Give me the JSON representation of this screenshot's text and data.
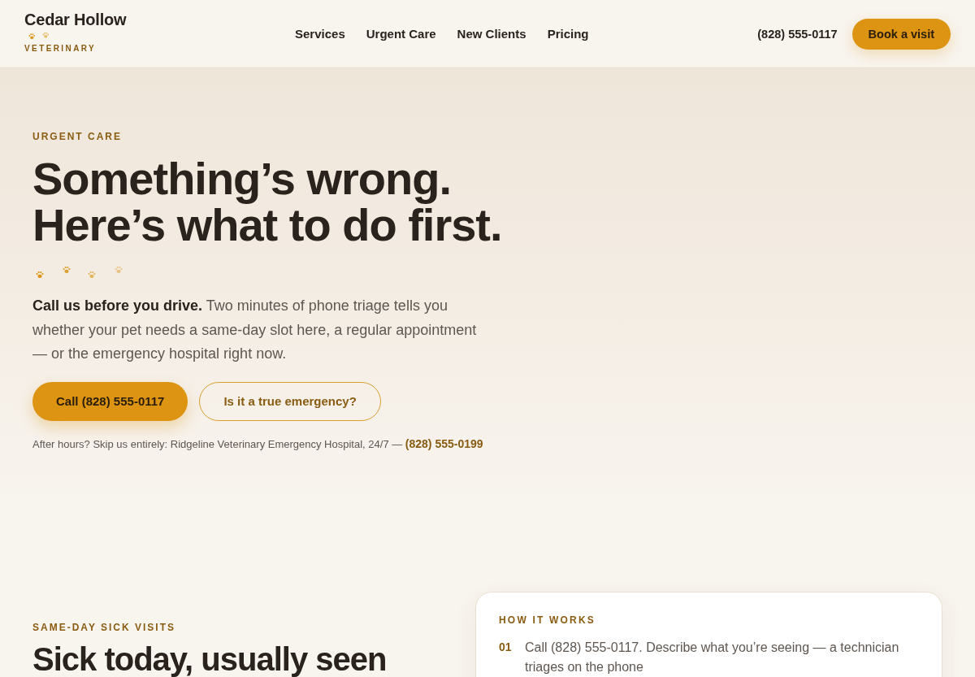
{
  "header": {
    "logo": {
      "name": "Cedar Hollow",
      "tagline": "VETERINARY"
    },
    "nav": [
      "Services",
      "Urgent Care",
      "New Clients",
      "Pricing"
    ],
    "phone": "(828) 555-0117",
    "cta": "Book a visit"
  },
  "hero": {
    "eyebrow": "URGENT CARE",
    "headline_lines": [
      "Something’s wrong.",
      "Here’s what to do first."
    ],
    "lead": "**Call us before you drive.** Two minutes of phone triage tells you whether your pet needs a same-day slot here, a regular appointment — or the emergency hospital right now.",
    "buttons": [
      {
        "label": "Call (828) 555-0117",
        "kind": "primary"
      },
      {
        "label": "Is it a true emergency?",
        "kind": "secondary"
      }
    ],
    "after_hours": {
      "text": "After hours? Skip us entirely: Ridgeline Veterinary Emergency Hospital, 24/7 —",
      "link": "(828) 555-0199"
    }
  },
  "sick_visits": {
    "eyebrow": "SAME-DAY SICK VISITS",
    "heading": "Sick today, usually seen"
  },
  "how_it_works": {
    "title": "HOW IT WORKS",
    "steps": [
      {
        "number": "01",
        "text": "Call (828) 555-0117. Describe what you’re seeing — a technician triages on the phone"
      }
    ]
  }
}
